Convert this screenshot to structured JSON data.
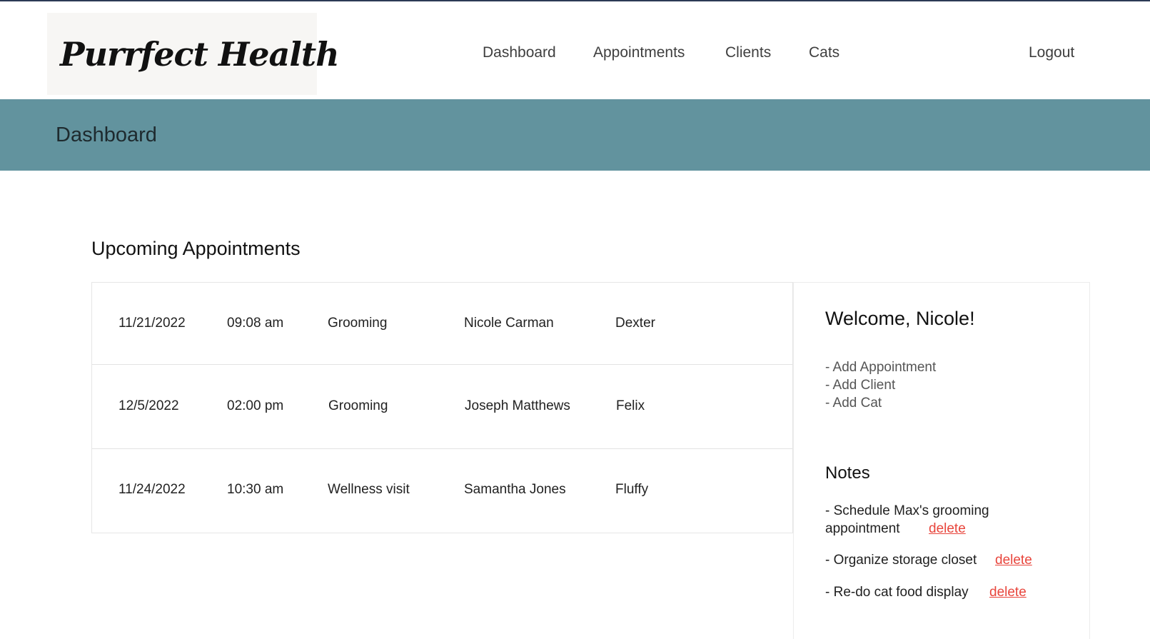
{
  "header": {
    "logo_text": "Purrfect Health",
    "logo_icon": "cat-icon",
    "nav": [
      "Dashboard",
      "Appointments",
      "Clients",
      "Cats"
    ],
    "logout": "Logout"
  },
  "band": {
    "title": "Dashboard"
  },
  "appointments": {
    "title": "Upcoming Appointments",
    "rows": [
      {
        "date": "11/21/2022",
        "time": "09:08 am",
        "service": "Grooming",
        "client": "Nicole Carman",
        "cat": "Dexter"
      },
      {
        "date": "12/5/2022",
        "time": "02:00 pm",
        "service": "Grooming",
        "client": "Joseph Matthews",
        "cat": "Felix"
      },
      {
        "date": "11/24/2022",
        "time": "10:30 am",
        "service": "Wellness visit",
        "client": "Samantha Jones",
        "cat": "Fluffy"
      }
    ]
  },
  "panel": {
    "welcome": "Welcome, Nicole!",
    "links": [
      "- Add Appointment",
      "- Add Client",
      "- Add Cat"
    ],
    "notes_title": "Notes",
    "notes": [
      {
        "line1": "- Schedule Max's grooming",
        "line2": "appointment",
        "delete": "delete"
      },
      {
        "line1": "- Organize storage closet",
        "delete": "delete"
      },
      {
        "line1": "- Re-do cat food display",
        "delete": "delete"
      }
    ],
    "link_color": "#555555",
    "delete_color": "#e8453c"
  },
  "colors": {
    "band": "#62939e",
    "top_border": "#2b3a55"
  }
}
